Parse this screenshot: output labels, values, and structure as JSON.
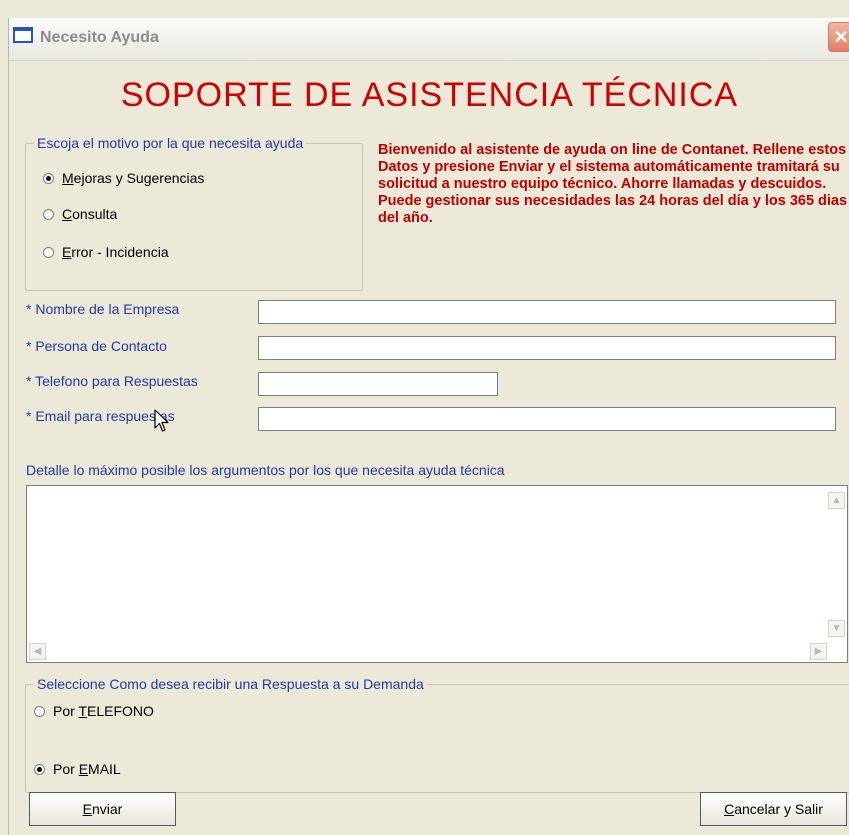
{
  "window": {
    "title": "Necesito Ayuda",
    "close_glyph": "✕"
  },
  "main_title": "SOPORTE DE ASISTENCIA TÉCNICA",
  "reason_group": {
    "legend": "Escoja el motivo por la que necesita ayuda",
    "options": [
      {
        "mnemonic": "M",
        "rest": "ejoras y Sugerencias",
        "checked": true
      },
      {
        "mnemonic": "C",
        "rest": "onsulta",
        "checked": false
      },
      {
        "mnemonic": "E",
        "rest": "rror - Incidencia",
        "checked": false
      }
    ]
  },
  "welcome_text": "Bienvenido al asistente de ayuda on line de Contanet. Rellene estos Datos y presione Enviar y el sistema automáticamente tramitará su solicitud a nuestro equipo técnico. Ahorre llamadas y descuidos. Puede gestionar sus necesidades las 24 horas del día y los 365 dias del año.",
  "fields": {
    "company_label": "* Nombre de la Empresa",
    "company_value": "",
    "contact_label": "* Persona de Contacto",
    "contact_value": "",
    "phone_label": "* Telefono para Respuestas",
    "phone_value": "",
    "email_label": "* Email para respuestas",
    "email_value": ""
  },
  "detail_label": "Detalle lo máximo posible los argumentos por los que necesita ayuda técnica",
  "detail_value": "",
  "response_group": {
    "legend": "Seleccione Como desea recibir una Respuesta a su Demanda",
    "phone": {
      "prefix": "Por ",
      "mnemonic": "T",
      "rest": "ELEFONO",
      "checked": false
    },
    "email": {
      "prefix": "Por ",
      "mnemonic": "E",
      "rest": "MAIL",
      "checked": true
    }
  },
  "buttons": {
    "send": {
      "mnemonic": "E",
      "rest": "nviar"
    },
    "cancel": {
      "mnemonic": "C",
      "rest": "ancelar y Salir"
    }
  },
  "icons": {
    "close": "close-icon",
    "window": "window-icon",
    "cursor": "arrow-cursor-icon"
  },
  "colors": {
    "title_red": "#d00000",
    "welcome_red": "#c00000",
    "label_blue": "#2139a5",
    "window_bg": "#ece9d8"
  }
}
